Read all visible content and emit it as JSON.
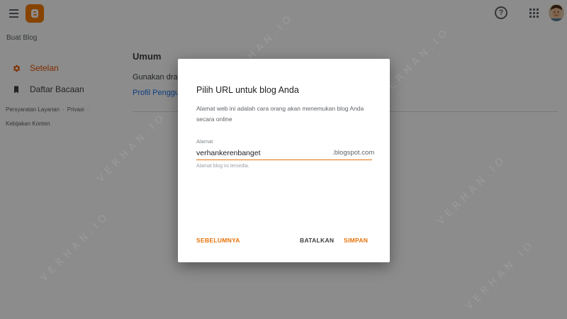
{
  "app": {
    "new_blog": "Buat Blog",
    "help_glyph": "?"
  },
  "sidebar": {
    "items": [
      {
        "label": "Setelan",
        "icon": "gear-icon",
        "active": true
      },
      {
        "label": "Daftar Bacaan",
        "icon": "bookmark-icon",
        "active": false
      }
    ],
    "footer": {
      "terms": "Persyaratan Layanan",
      "privacy": "Privasi",
      "content_policy": "Kebijakan Konten",
      "separator": "·"
    }
  },
  "main": {
    "section_title": "Umum",
    "row1_text": "Gunakan draf",
    "row2_link": "Profil Penggu"
  },
  "dialog": {
    "title": "Pilih URL untuk blog Anda",
    "description": "Alamat web ini adalah cara orang akan menemukan blog Anda secara online",
    "field_label": "Alamat",
    "field_value": "verhankerenbanget",
    "suffix": ".blogspot.com",
    "helper_text": "Alamat blog ini tersedia.",
    "buttons": {
      "previous": "SEBELUMNYA",
      "cancel": "BATALKAN",
      "save": "SIMPAN"
    }
  },
  "watermark": "VERHAN.IO",
  "colors": {
    "accent": "#e8710a",
    "blogger_orange": "#f57c00",
    "active_nav": "#e65100",
    "link": "#1a73e8",
    "scrim": "rgba(0,0,0,0.45)"
  }
}
